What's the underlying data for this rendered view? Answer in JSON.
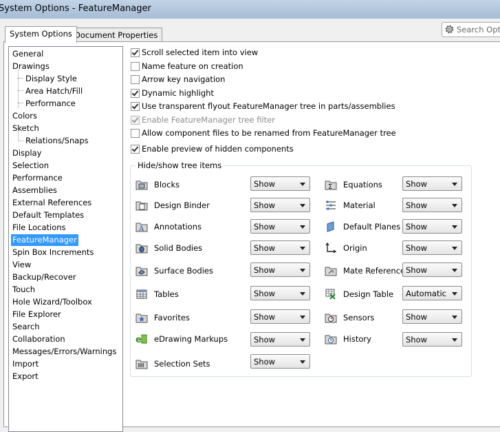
{
  "window": {
    "title": "System Options - FeatureManager"
  },
  "tabs": [
    {
      "label": "System Options",
      "active": true
    },
    {
      "label": "Document Properties",
      "active": false
    }
  ],
  "search": {
    "placeholder": "Search Optic",
    "icon": "gear-icon"
  },
  "nav": [
    {
      "label": "General",
      "level": 0
    },
    {
      "label": "Drawings",
      "level": 0
    },
    {
      "label": "Display Style",
      "level": 1
    },
    {
      "label": "Area Hatch/Fill",
      "level": 1
    },
    {
      "label": "Performance",
      "level": 1
    },
    {
      "label": "Colors",
      "level": 0
    },
    {
      "label": "Sketch",
      "level": 0
    },
    {
      "label": "Relations/Snaps",
      "level": 1
    },
    {
      "label": "Display",
      "level": 0
    },
    {
      "label": "Selection",
      "level": 0
    },
    {
      "label": "Performance",
      "level": 0
    },
    {
      "label": "Assemblies",
      "level": 0
    },
    {
      "label": "External References",
      "level": 0
    },
    {
      "label": "Default Templates",
      "level": 0
    },
    {
      "label": "File Locations",
      "level": 0
    },
    {
      "label": "FeatureManager",
      "level": 0,
      "selected": true
    },
    {
      "label": "Spin Box Increments",
      "level": 0
    },
    {
      "label": "View",
      "level": 0
    },
    {
      "label": "Backup/Recover",
      "level": 0
    },
    {
      "label": "Touch",
      "level": 0
    },
    {
      "label": "Hole Wizard/Toolbox",
      "level": 0
    },
    {
      "label": "File Explorer",
      "level": 0
    },
    {
      "label": "Search",
      "level": 0
    },
    {
      "label": "Collaboration",
      "level": 0
    },
    {
      "label": "Messages/Errors/Warnings",
      "level": 0
    },
    {
      "label": "Import",
      "level": 0
    },
    {
      "label": "Export",
      "level": 0
    }
  ],
  "options": [
    {
      "label": "Scroll selected item into view",
      "checked": true,
      "disabled": false
    },
    {
      "label": "Name feature on creation",
      "checked": false,
      "disabled": false
    },
    {
      "label": "Arrow key navigation",
      "checked": false,
      "disabled": false
    },
    {
      "label": "Dynamic highlight",
      "checked": true,
      "disabled": false
    },
    {
      "label": "Use transparent flyout FeatureManager tree in parts/assemblies",
      "checked": true,
      "disabled": false
    },
    {
      "label": "Enable FeatureManager tree filter",
      "checked": true,
      "disabled": true
    },
    {
      "label": "Allow component files to be renamed from FeatureManager tree",
      "checked": false,
      "disabled": false
    },
    {
      "label": "Enable preview of hidden components",
      "checked": true,
      "disabled": false
    }
  ],
  "tree_items": {
    "title": "Hide/show tree items",
    "left": [
      {
        "label": "Blocks",
        "value": "Show",
        "icon": "blocks-icon"
      },
      {
        "label": "Design Binder",
        "value": "Show",
        "icon": "design-binder-icon"
      },
      {
        "label": "Annotations",
        "value": "Show",
        "icon": "annotations-icon"
      },
      {
        "label": "Solid Bodies",
        "value": "Show",
        "icon": "solid-bodies-icon"
      },
      {
        "label": "Surface Bodies",
        "value": "Show",
        "icon": "surface-bodies-icon"
      },
      {
        "label": "Tables",
        "value": "Show",
        "icon": "tables-icon"
      },
      {
        "label": "Favorites",
        "value": "Show",
        "icon": "favorites-icon"
      },
      {
        "label": "eDrawing Markups",
        "value": "Show",
        "icon": "edrawing-markups-icon"
      },
      {
        "label": "Selection Sets",
        "value": "Show",
        "icon": "selection-sets-icon"
      }
    ],
    "right": [
      {
        "label": "Equations",
        "value": "Show",
        "icon": "equations-icon"
      },
      {
        "label": "Material",
        "value": "Show",
        "icon": "material-icon"
      },
      {
        "label": "Default Planes",
        "value": "Show",
        "icon": "default-planes-icon"
      },
      {
        "label": "Origin",
        "value": "Show",
        "icon": "origin-icon"
      },
      {
        "label": "Mate References",
        "value": "Show",
        "icon": "mate-references-icon"
      },
      {
        "label": "Design Table",
        "value": "Automatic",
        "icon": "design-table-icon"
      },
      {
        "label": "Sensors",
        "value": "Show",
        "icon": "sensors-icon"
      },
      {
        "label": "History",
        "value": "Show",
        "icon": "history-icon"
      }
    ]
  },
  "colors": {
    "selection": "#3399ff",
    "title_bar": "#b4c8e0"
  }
}
